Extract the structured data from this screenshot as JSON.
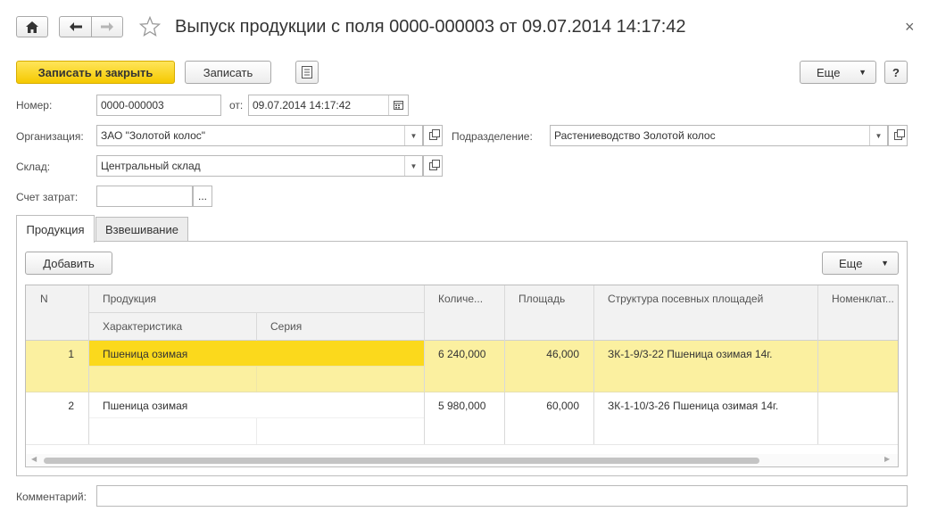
{
  "window": {
    "title": "Выпуск продукции с поля 0000-000003 от 09.07.2014 14:17:42",
    "close_glyph": "×"
  },
  "toolbar": {
    "save_close_label": "Записать и закрыть",
    "save_label": "Записать",
    "more_label": "Еще",
    "help_label": "?"
  },
  "form": {
    "number_label": "Номер:",
    "number_value": "0000-000003",
    "date_label": "от:",
    "date_value": "09.07.2014 14:17:42",
    "org_label": "Организация:",
    "org_value": "ЗАО \"Золотой колос\"",
    "dept_label": "Подразделение:",
    "dept_value": "Растениеводство Золотой колос",
    "warehouse_label": "Склад:",
    "warehouse_value": "Центральный склад",
    "account_label": "Счет затрат:",
    "account_value": "",
    "ellipsis": "...",
    "comment_label": "Комментарий:",
    "comment_value": ""
  },
  "tabs": [
    {
      "label": "Продукция",
      "active": true
    },
    {
      "label": "Взвешивание",
      "active": false
    }
  ],
  "table_toolbar": {
    "add_label": "Добавить",
    "more_label": "Еще"
  },
  "table": {
    "headers": {
      "n": "N",
      "product": "Продукция",
      "characteristic": "Характеристика",
      "series": "Серия",
      "quantity": "Количе...",
      "area": "Площадь",
      "structure": "Структура посевных площадей",
      "nomenclature": "Номенклат..."
    },
    "rows": [
      {
        "n": "1",
        "product": "Пшеница озимая",
        "characteristic": "",
        "series": "",
        "quantity": "6 240,000",
        "area": "46,000",
        "structure": "ЗК-1-9/3-22 Пшеница озимая 14г.",
        "nomenclature": ""
      },
      {
        "n": "2",
        "product": "Пшеница озимая",
        "characteristic": "",
        "series": "",
        "quantity": "5 980,000",
        "area": "60,000",
        "structure": "ЗК-1-10/3-26 Пшеница озимая 14г.",
        "nomenclature": ""
      }
    ]
  },
  "colors": {
    "primary_button": "#f5c900",
    "selected_row": "#fbf0a0",
    "selected_cell": "#fbd91c"
  }
}
